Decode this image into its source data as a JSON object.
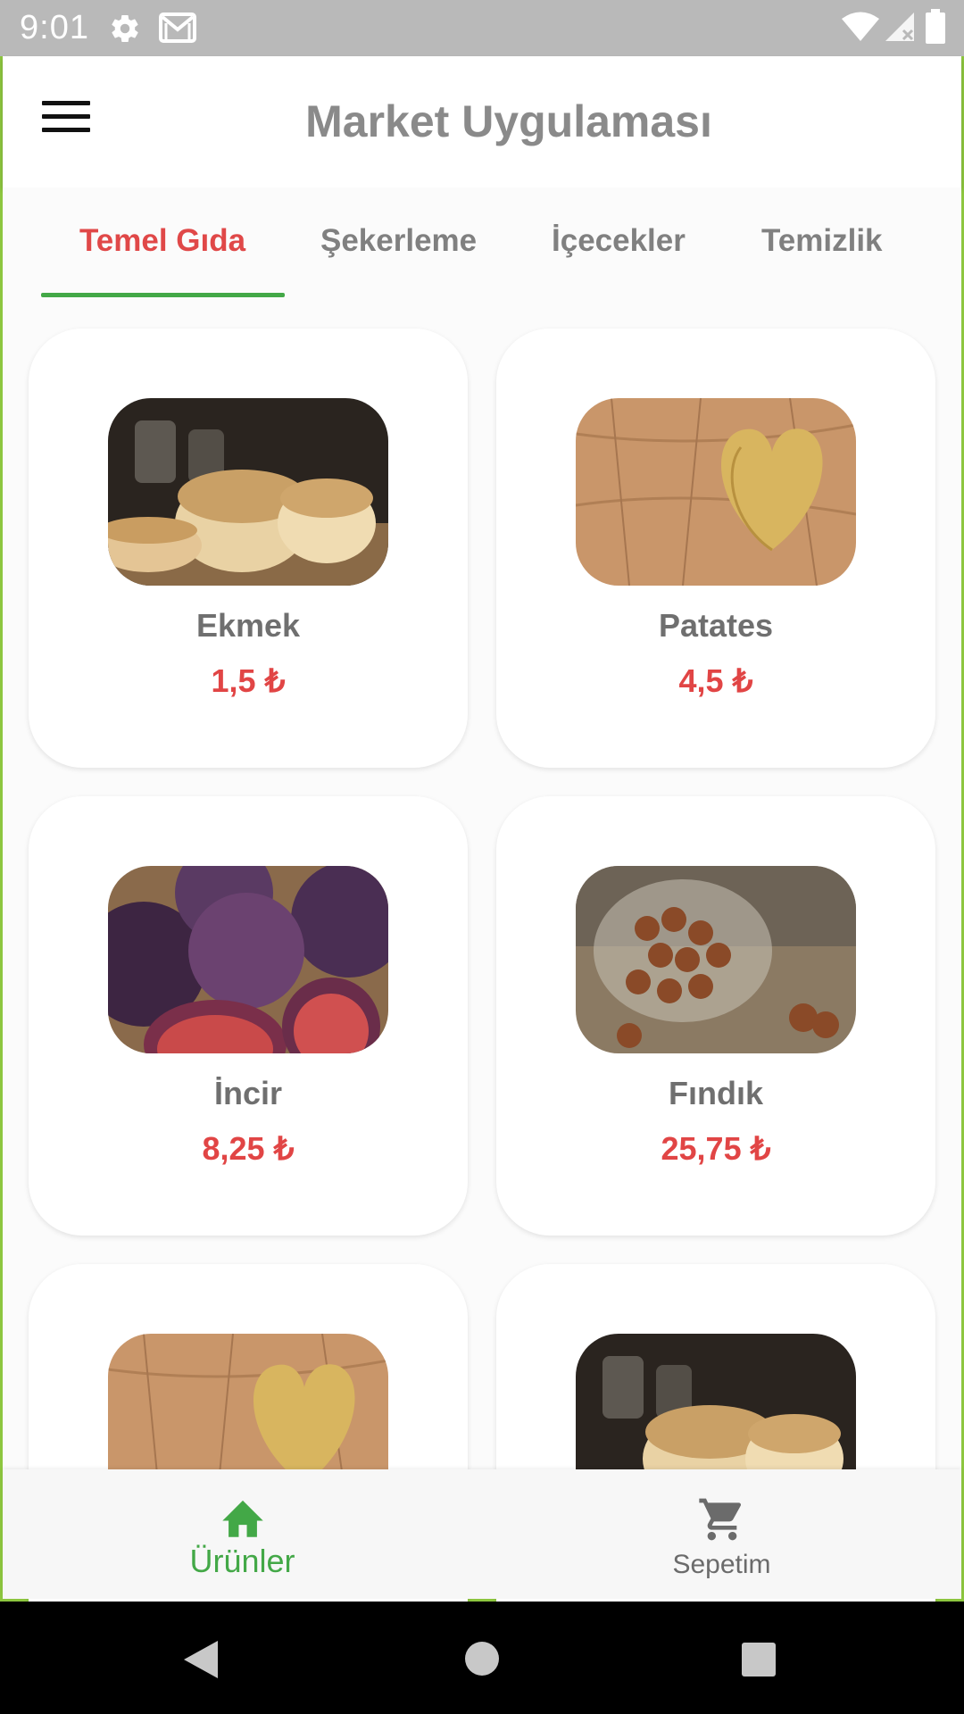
{
  "status_bar": {
    "time": "9:01"
  },
  "app_bar": {
    "title": "Market Uygulaması"
  },
  "tabs": [
    {
      "label": "Temel Gıda",
      "active": true
    },
    {
      "label": "Şekerleme",
      "active": false
    },
    {
      "label": "İçecekler",
      "active": false
    },
    {
      "label": "Temizlik",
      "active": false
    }
  ],
  "products": [
    {
      "name": "Ekmek",
      "price": "1,5 ₺",
      "image": "bread"
    },
    {
      "name": "Patates",
      "price": "4,5 ₺",
      "image": "potato"
    },
    {
      "name": "İncir",
      "price": "8,25 ₺",
      "image": "figs"
    },
    {
      "name": "Fındık",
      "price": "25,75 ₺",
      "image": "hazelnuts"
    },
    {
      "image": "potato"
    },
    {
      "image": "bread"
    }
  ],
  "bottom_nav": [
    {
      "label": "Ürünler",
      "icon": "home-icon",
      "active": true
    },
    {
      "label": "Sepetim",
      "icon": "cart-icon",
      "active": false
    }
  ],
  "colors": {
    "accent_green": "#43a847",
    "price_red": "#e14545",
    "active_tab_red": "#e04848",
    "status_bar_gray": "#b9b9b9"
  }
}
